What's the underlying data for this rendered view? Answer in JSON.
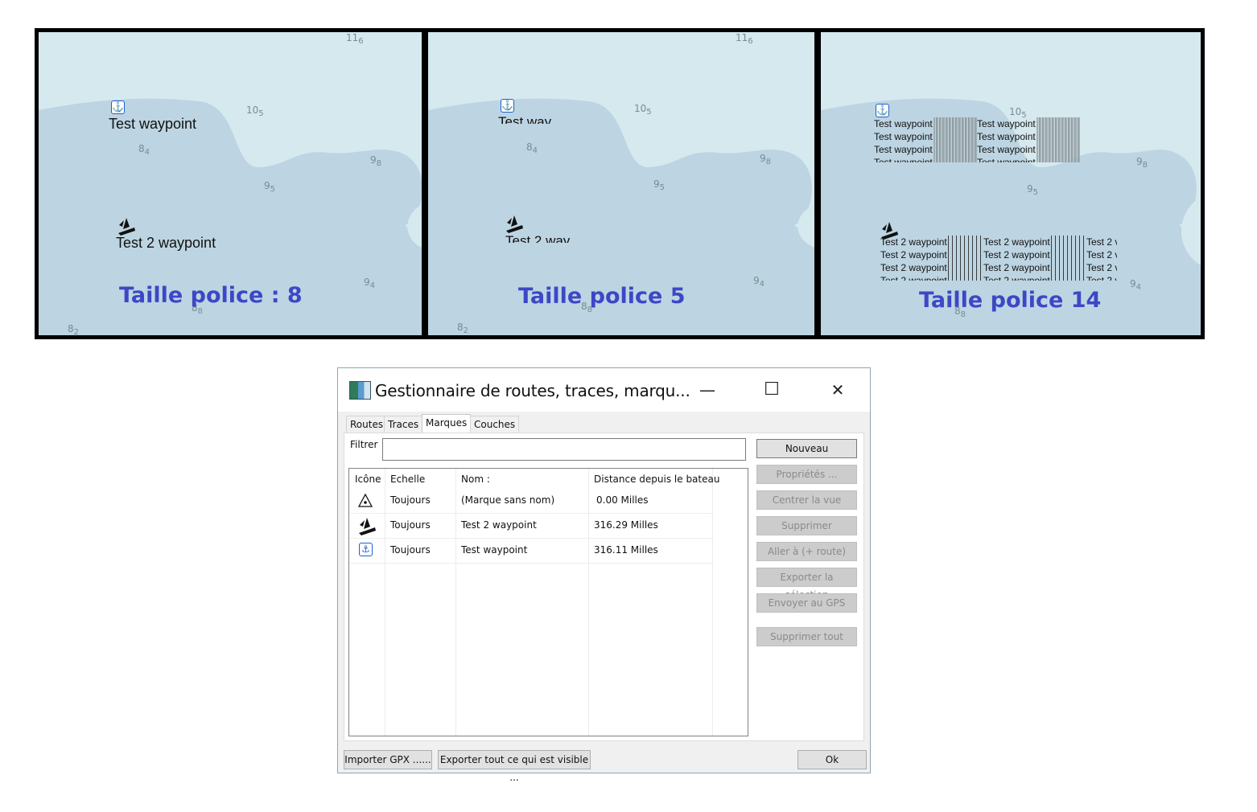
{
  "panels": [
    {
      "caption": "Taille police : 8",
      "wp1_label": "Test waypoint",
      "wp2_label": "Test 2 waypoint",
      "soundings": [
        {
          "main": "11",
          "sub": "6"
        },
        {
          "main": "10",
          "sub": "5"
        },
        {
          "main": "8",
          "sub": "4"
        },
        {
          "main": "9",
          "sub": "8"
        },
        {
          "main": "9",
          "sub": "5"
        },
        {
          "main": "9",
          "sub": "4"
        },
        {
          "main": "8",
          "sub": "8"
        },
        {
          "main": "8",
          "sub": "2"
        }
      ]
    },
    {
      "caption": "Taille police 5",
      "wp1_label": "Test way",
      "wp2_label": "Test 2 way",
      "soundings": [
        {
          "main": "11",
          "sub": "6"
        },
        {
          "main": "10",
          "sub": "5"
        },
        {
          "main": "8",
          "sub": "4"
        },
        {
          "main": "9",
          "sub": "8"
        },
        {
          "main": "9",
          "sub": "5"
        },
        {
          "main": "9",
          "sub": "4"
        },
        {
          "main": "8",
          "sub": "8"
        },
        {
          "main": "8",
          "sub": "2"
        }
      ]
    },
    {
      "caption": "Taille police 14",
      "wp1_label": "Test waypoint",
      "wp2_label": "Test 2 waypoint",
      "wp2_label_cut": "Test 2 v",
      "soundings": [
        {
          "main": "10",
          "sub": "5"
        },
        {
          "main": "9",
          "sub": "8"
        },
        {
          "main": "9",
          "sub": "5"
        },
        {
          "main": "9",
          "sub": "4"
        },
        {
          "main": "8",
          "sub": "8"
        }
      ]
    }
  ],
  "dialog": {
    "title": "Gestionnaire de routes, traces, marqu...",
    "minimize": "—",
    "maximize": "☐",
    "close": "✕",
    "tabs": [
      "Routes",
      "Traces",
      "Marques",
      "Couches"
    ],
    "active_tab": "Marques",
    "filter_label": "Filtrer",
    "filter_value": "",
    "columns": [
      "Icône",
      "Echelle",
      "Nom :",
      "Distance depuis le bateau"
    ],
    "rows": [
      {
        "icon": "triangle-mark-icon",
        "scale": "Toujours",
        "name": "(Marque sans nom)",
        "distance": "0.00 Milles"
      },
      {
        "icon": "boat-icon",
        "scale": "Toujours",
        "name": "Test 2 waypoint",
        "distance": "316.29 Milles"
      },
      {
        "icon": "anchor-icon",
        "scale": "Toujours",
        "name": "Test waypoint",
        "distance": "316.11 Milles"
      }
    ],
    "side_buttons": {
      "new": "Nouveau",
      "properties": "Propriétés ...",
      "center": "Centrer la vue",
      "delete": "Supprimer",
      "goto": "Aller à (+ route)",
      "export_sel": "Exporter la sélection",
      "send_gps": "Envoyer au GPS",
      "delete_all": "Supprimer tout"
    },
    "bottom_buttons": {
      "import": "Importer GPX ......",
      "export_visible": "Exporter tout ce qui est visible ...",
      "ok": "Ok"
    }
  },
  "colors": {
    "land_water_light": "#d5e9ef",
    "water_deep": "#bdd5e2",
    "caption": "#3d47c6",
    "anchor": "#1b5fd6"
  }
}
